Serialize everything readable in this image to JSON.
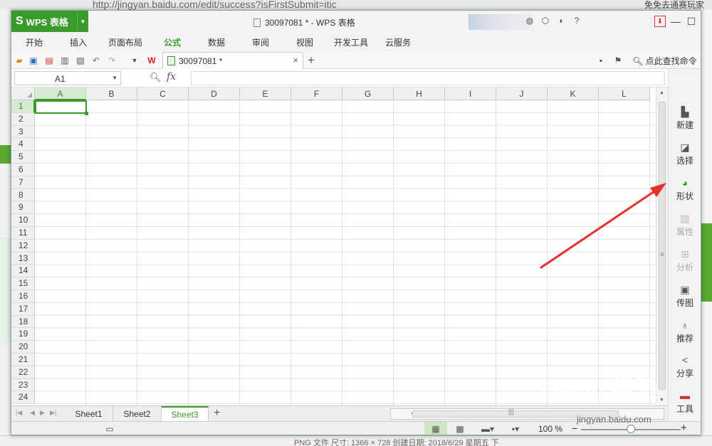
{
  "background": {
    "url_text": "http://jingyan.baidu.com/edit/success?isFirstSubmit=itic",
    "right_text": "免免去通赛玩家",
    "bottom_text": "PNG 文件    尺寸: 1366 × 728    创建日期: 2018/6/29 星期五 下"
  },
  "app": {
    "name": "WPS 表格",
    "logo": "S",
    "window_title": "30097081 * - WPS 表格"
  },
  "menu": [
    "开始",
    "插入",
    "页面布局",
    "公式",
    "数据",
    "审阅",
    "视图",
    "开发工具",
    "云服务"
  ],
  "menu_active": "公式",
  "toolbar": {
    "doc_tab_label": "30097081 *",
    "find_command": "点此查找命令"
  },
  "formula_bar": {
    "cell_ref": "A1",
    "fx": "fx",
    "value": ""
  },
  "columns": [
    "A",
    "B",
    "C",
    "D",
    "E",
    "F",
    "G",
    "H",
    "I",
    "J",
    "K",
    "L"
  ],
  "rows": [
    "1",
    "2",
    "3",
    "4",
    "5",
    "6",
    "7",
    "8",
    "9",
    "10",
    "11",
    "12",
    "13",
    "14",
    "15",
    "16",
    "17",
    "18",
    "19",
    "20",
    "21",
    "22",
    "23",
    "24"
  ],
  "selected_cell": "A1",
  "right_panel": [
    {
      "label": "新建",
      "icon": "new-doc-icon",
      "enabled": true
    },
    {
      "label": "选择",
      "icon": "select-icon",
      "enabled": true
    },
    {
      "label": "形状",
      "icon": "shape-icon",
      "enabled": true
    },
    {
      "label": "属性",
      "icon": "properties-icon",
      "enabled": false
    },
    {
      "label": "分析",
      "icon": "analysis-icon",
      "enabled": false
    },
    {
      "label": "传图",
      "icon": "image-upload-icon",
      "enabled": true
    },
    {
      "label": "推荐",
      "icon": "recommend-icon",
      "enabled": true
    },
    {
      "label": "分享",
      "icon": "share-icon",
      "enabled": true
    },
    {
      "label": "工具",
      "icon": "toolbox-icon",
      "enabled": true
    }
  ],
  "sheets": [
    "Sheet1",
    "Sheet2",
    "Sheet3"
  ],
  "active_sheet": "Sheet3",
  "status": {
    "zoom": "100 %"
  },
  "watermark": {
    "text": "Baidu 经验",
    "url": "jingyan.baidu.com"
  },
  "colors": {
    "accent": "#3a9a2a",
    "annotation_arrow": "#e8302a"
  }
}
